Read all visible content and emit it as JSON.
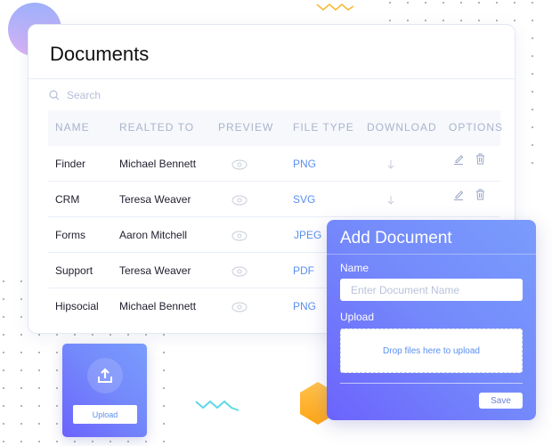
{
  "documents": {
    "title": "Documents",
    "search": {
      "placeholder": "Search",
      "icon": "search-icon"
    },
    "columns": [
      "NAME",
      "REALTED TO",
      "PREVIEW",
      "FILE TYPE",
      "DOWNLOAD",
      "OPTIONS"
    ],
    "rows": [
      {
        "name": "Finder",
        "related_to": "Michael Bennett",
        "file_type": "PNG",
        "download": true,
        "options": true
      },
      {
        "name": "CRM",
        "related_to": "Teresa Weaver",
        "file_type": "SVG",
        "download": true,
        "options": true
      },
      {
        "name": "Forms",
        "related_to": "Aaron Mitchell",
        "file_type": "JPEG",
        "download": false,
        "options": false
      },
      {
        "name": "Support",
        "related_to": "Teresa Weaver",
        "file_type": "PDF",
        "download": false,
        "options": false
      },
      {
        "name": "Hipsocial",
        "related_to": "Michael Bennett",
        "file_type": "PNG",
        "download": false,
        "options": false
      }
    ],
    "icons": {
      "preview": "eye-icon",
      "download": "arrow-down-icon",
      "edit": "pencil-icon",
      "delete": "trash-icon"
    }
  },
  "add_document": {
    "title": "Add Document",
    "name_label": "Name",
    "name_placeholder": "Enter Document Name",
    "upload_label": "Upload",
    "dropzone_text": "Drop files here to upload",
    "save_label": "Save"
  },
  "upload_widget": {
    "icon": "upload-icon",
    "button_label": "Upload"
  },
  "colors": {
    "accent_blue": "#5a8ff0",
    "card_gradient_start": "#6c63fc",
    "card_gradient_end": "#7a9cfc",
    "hexagon": "#ffb02e",
    "squiggle_top": "#f5b833",
    "squiggle_bottom": "#5fd8e6"
  }
}
